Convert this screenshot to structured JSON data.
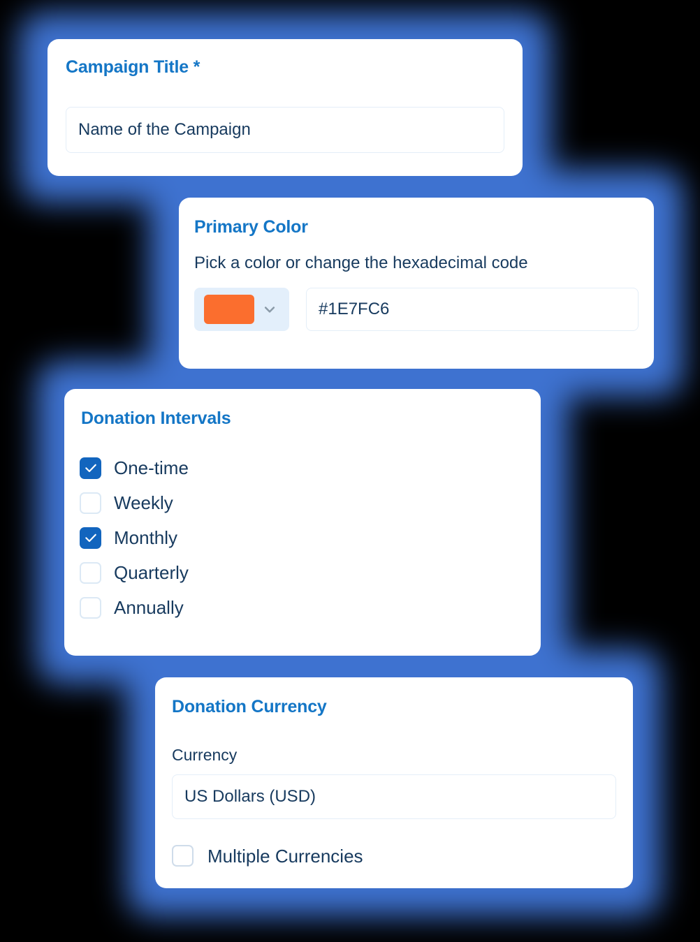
{
  "theme": {
    "heading_color": "#1476C6",
    "body_text_color": "#173A5E",
    "checkbox_checked_color": "#1265BE",
    "swatch_color": "#FB6E2E",
    "glow_color": "#3E72D0",
    "background_color": "#000000",
    "card_background": "#FFFFFF"
  },
  "campaign_title_card": {
    "heading": "Campaign Title *",
    "input_value": "Name of the Campaign"
  },
  "primary_color_card": {
    "heading": "Primary Color",
    "description": "Pick a color or change the hexadecimal code",
    "swatch_color": "#FB6E2E",
    "dropdown_icon": "chevron-down-icon",
    "hex_value": "#1E7FC6"
  },
  "donation_intervals_card": {
    "heading": "Donation Intervals",
    "options": [
      {
        "label": "One-time",
        "checked": true
      },
      {
        "label": "Weekly",
        "checked": false
      },
      {
        "label": "Monthly",
        "checked": true
      },
      {
        "label": "Quarterly",
        "checked": false
      },
      {
        "label": "Annually",
        "checked": false
      }
    ]
  },
  "donation_currency_card": {
    "heading": "Donation Currency",
    "field_label": "Currency",
    "selected_currency": "US Dollars (USD)",
    "multiple_currencies": {
      "label": "Multiple Currencies",
      "checked": false
    }
  }
}
